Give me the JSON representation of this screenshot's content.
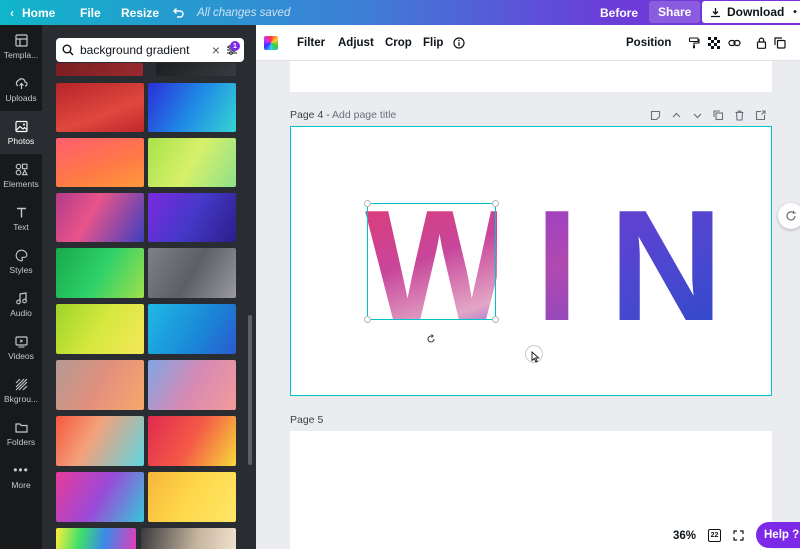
{
  "topbar": {
    "home_label": "Home",
    "file_label": "File",
    "resize_label": "Resize",
    "save_status": "All changes saved",
    "before_label": "Before",
    "share_label": "Share",
    "download_label": "Download"
  },
  "rail": {
    "items": [
      {
        "label": "Templa...",
        "icon": "template-icon"
      },
      {
        "label": "Uploads",
        "icon": "upload-icon"
      },
      {
        "label": "Photos",
        "icon": "image-icon"
      },
      {
        "label": "Elements",
        "icon": "shapes-icon"
      },
      {
        "label": "Text",
        "icon": "text-icon"
      },
      {
        "label": "Styles",
        "icon": "palette-icon"
      },
      {
        "label": "Audio",
        "icon": "music-icon"
      },
      {
        "label": "Videos",
        "icon": "video-icon"
      },
      {
        "label": "Bkgrou...",
        "icon": "pattern-icon"
      },
      {
        "label": "Folders",
        "icon": "folder-icon"
      },
      {
        "label": "More",
        "icon": "more-icon"
      }
    ]
  },
  "search": {
    "value": "background gradient",
    "filter_count": "1"
  },
  "toolbar": {
    "filter_label": "Filter",
    "adjust_label": "Adjust",
    "crop_label": "Crop",
    "flip_label": "Flip",
    "position_label": "Position"
  },
  "pages": {
    "page4_label": "Page 4 - ",
    "page4_title_placeholder": "Add page title",
    "page5_label": "Page 5"
  },
  "design": {
    "letters": [
      "W",
      "I",
      "N"
    ]
  },
  "zoom": {
    "value": "36%",
    "page_count": "22"
  },
  "help_label": "Help ?",
  "colors": {
    "accent": "#00c4cc",
    "brand_purple": "#7d2ae8",
    "rail_bg": "#18191b",
    "panel_bg": "#292c31"
  }
}
